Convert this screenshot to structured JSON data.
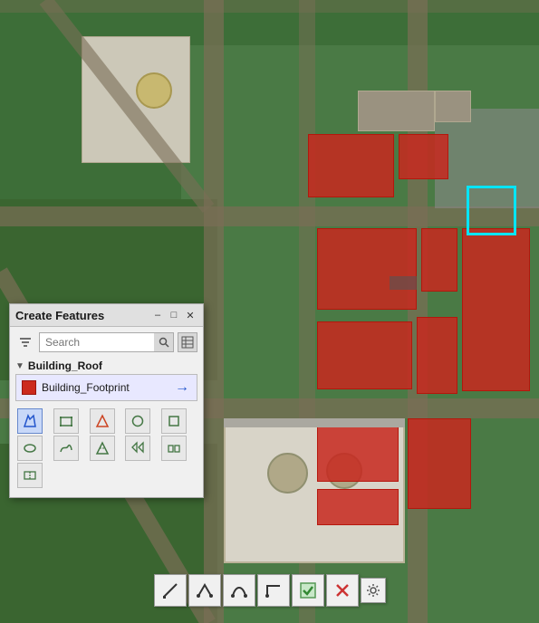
{
  "panel": {
    "title": "Create Features",
    "search_placeholder": "Search",
    "minimize_label": "–",
    "restore_label": "□",
    "close_label": "✕",
    "layer_name": "Building_Roof",
    "feature_name": "Building_Footprint"
  },
  "tools": [
    {
      "id": "sketch",
      "label": "✏",
      "tooltip": "Sketch tool",
      "active": true
    },
    {
      "id": "rectangle",
      "label": "▭",
      "tooltip": "Rectangle tool",
      "active": false
    },
    {
      "id": "triangle",
      "label": "△",
      "tooltip": "Triangle tool",
      "active": false
    },
    {
      "id": "circle",
      "label": "○",
      "tooltip": "Circle tool",
      "active": false
    },
    {
      "id": "square-outline",
      "label": "□",
      "tooltip": "Square outline tool",
      "active": false
    },
    {
      "id": "ellipse",
      "label": "◯",
      "tooltip": "Ellipse tool",
      "active": false
    },
    {
      "id": "curved",
      "label": "⌒",
      "tooltip": "Curved tool",
      "active": false
    },
    {
      "id": "polygon",
      "label": "⬡",
      "tooltip": "Polygon tool",
      "active": false
    },
    {
      "id": "zigzag",
      "label": "⋀",
      "tooltip": "Zigzag tool",
      "active": false
    },
    {
      "id": "multipart",
      "label": "⊡",
      "tooltip": "Multipart tool",
      "active": false
    },
    {
      "id": "reshape",
      "label": "⊡",
      "tooltip": "Reshape tool",
      "active": false
    }
  ],
  "bottom_toolbar": [
    {
      "id": "diagonal-line",
      "label": "◢",
      "tooltip": "Diagonal segment"
    },
    {
      "id": "arc",
      "label": "∧",
      "tooltip": "Arc segment"
    },
    {
      "id": "curve",
      "label": "∫",
      "tooltip": "Curve segment"
    },
    {
      "id": "angle",
      "label": "∟",
      "tooltip": "Right angle segment"
    },
    {
      "id": "finish",
      "label": "✓",
      "tooltip": "Finish sketch"
    },
    {
      "id": "delete",
      "label": "✕",
      "tooltip": "Delete sketch"
    }
  ],
  "colors": {
    "building_red": "#cc2a1e",
    "selected_cyan": "#00e5ff",
    "panel_bg": "#f0f0f0",
    "map_green": "#3a7a35"
  }
}
